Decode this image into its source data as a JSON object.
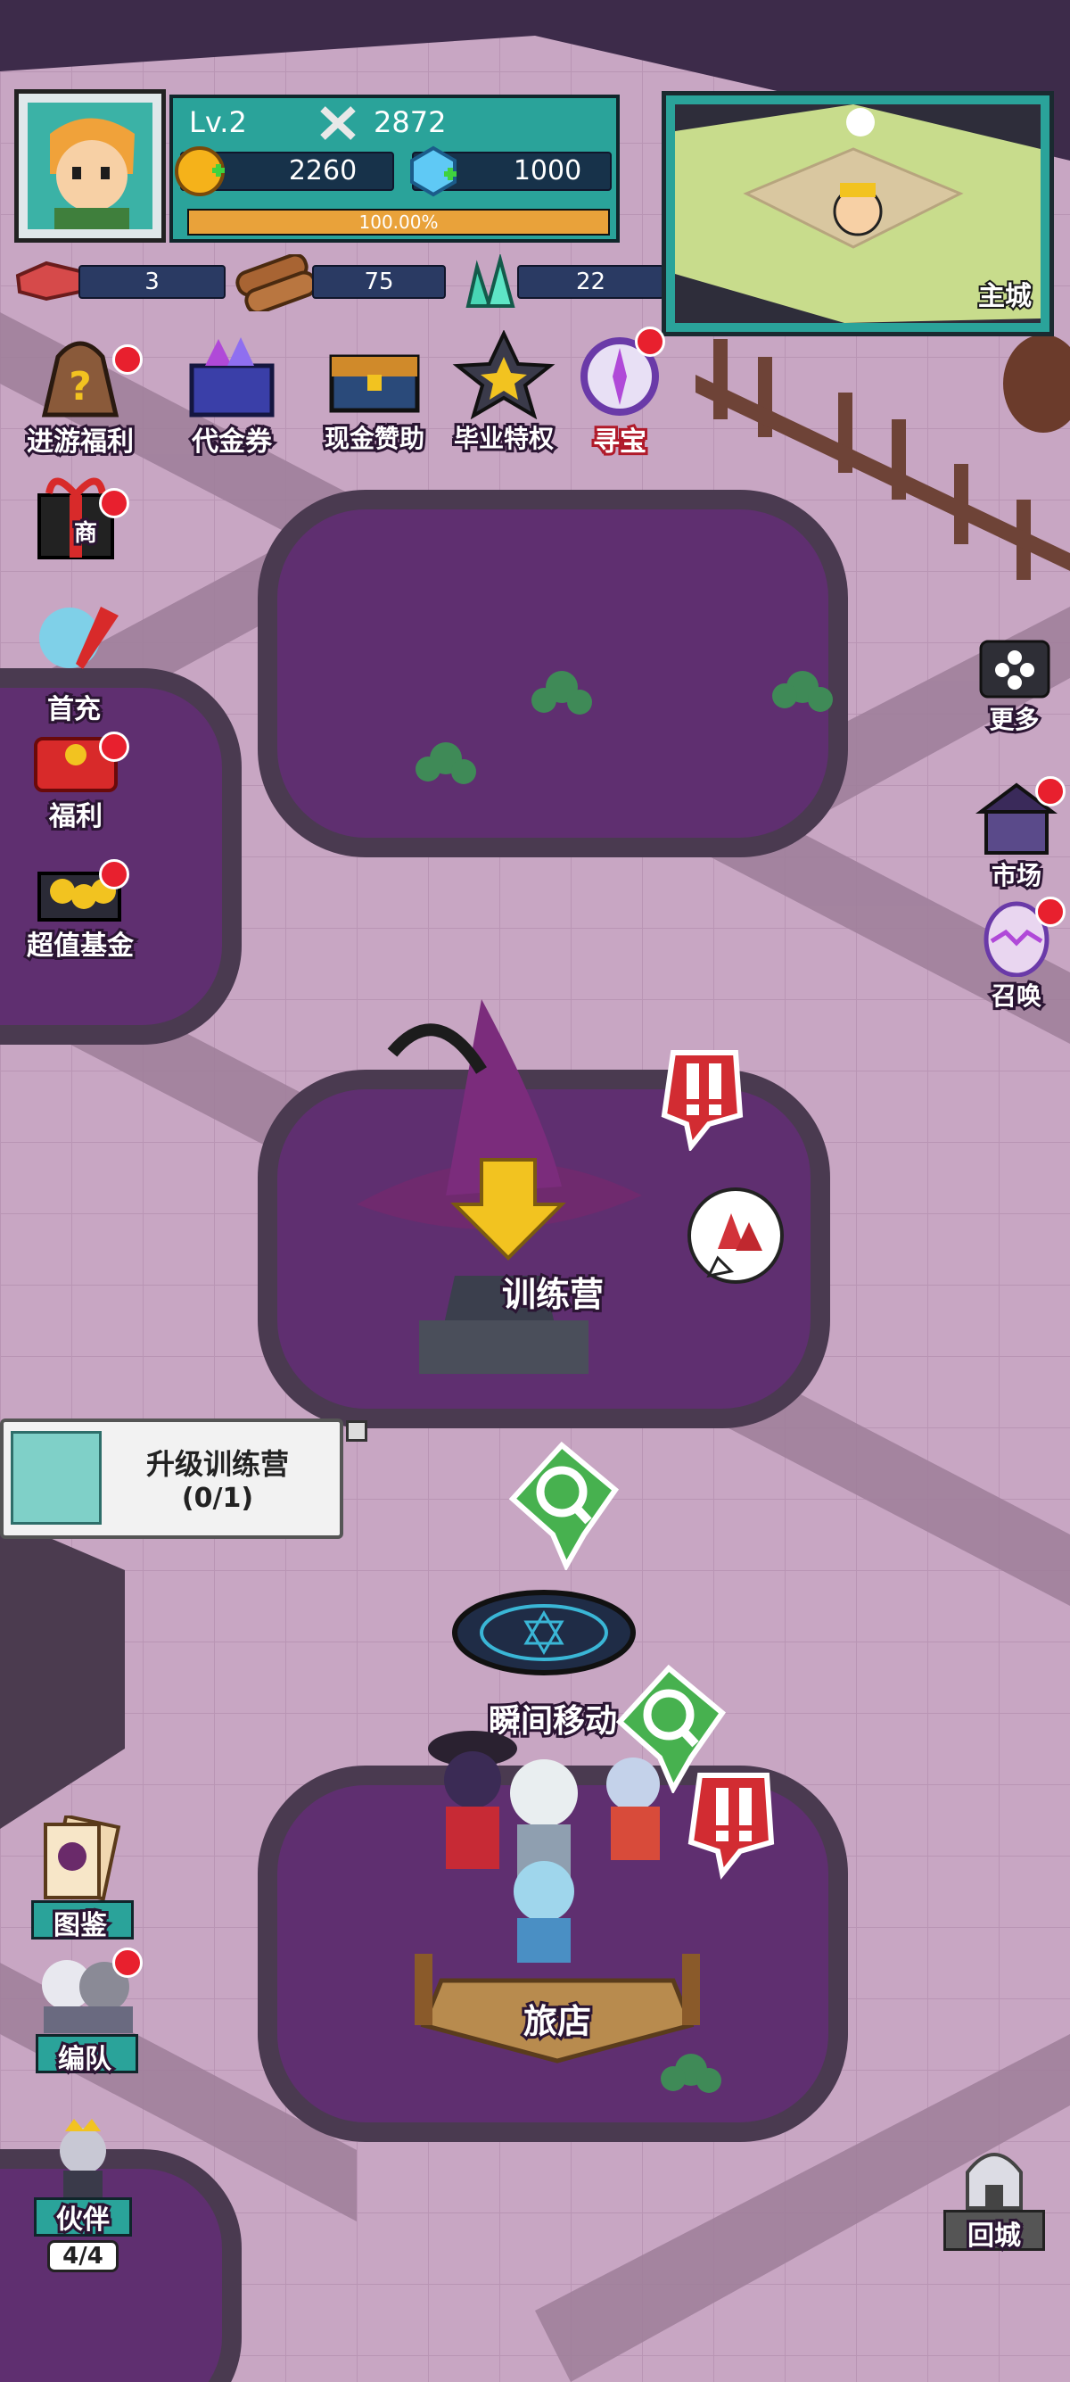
{
  "player": {
    "level": "Lv.2",
    "power": "2872",
    "gold": "2260",
    "diamond": "1000",
    "exp_percent": "100.00%",
    "exp_fraction": 1.0
  },
  "resources": [
    {
      "name": "ore",
      "icon": "ore-icon",
      "value": "3"
    },
    {
      "name": "wood",
      "icon": "wood-icon",
      "value": "75"
    },
    {
      "name": "crystal",
      "icon": "crystal-icon",
      "value": "22"
    }
  ],
  "minimap": {
    "label": "主城"
  },
  "top_menu": [
    {
      "label": "进游福利",
      "icon": "lucky-bag-icon",
      "badge": true
    },
    {
      "label": "代金券",
      "icon": "gem-box-icon",
      "badge": false
    },
    {
      "label": "现金赞助",
      "icon": "chest-icon",
      "badge": false
    },
    {
      "label": "毕业特权",
      "icon": "star-medal-icon",
      "badge": false
    },
    {
      "label": "寻宝",
      "icon": "treasure-wheel-icon",
      "badge": true
    }
  ],
  "left_menu": [
    {
      "label": "商",
      "icon": "gift-icon",
      "badge": true
    },
    {
      "label": "首充",
      "icon": "hero-sword-icon",
      "badge": false
    },
    {
      "label": "福利",
      "icon": "red-packet-icon",
      "badge": true
    },
    {
      "label": "超值基金",
      "icon": "gold-chest-icon",
      "badge": true
    }
  ],
  "right_menu": [
    {
      "label": "更多",
      "icon": "more-icon",
      "badge": false
    },
    {
      "label": "市场",
      "icon": "market-icon",
      "badge": true
    },
    {
      "label": "召唤",
      "icon": "egg-icon",
      "badge": true
    }
  ],
  "buildings": {
    "training_camp": "训练营",
    "teleport": "瞬间移动",
    "inn": "旅店"
  },
  "quest": {
    "title": "升级训练营",
    "progress": "(0/1)"
  },
  "bottom_left_menu": [
    {
      "label": "图鉴",
      "icon": "cards-icon",
      "badge": false
    },
    {
      "label": "编队",
      "icon": "team-icon",
      "badge": true
    },
    {
      "label": "伙伴",
      "icon": "partner-icon",
      "badge": false,
      "count": "4/4"
    }
  ],
  "return_city": {
    "label": "回城"
  },
  "colors": {
    "ground": "#c9a8c4",
    "road": "#a98aa6",
    "plot": "#5e2f6e",
    "panel": "#2aa39a",
    "badge": "#e8202e"
  }
}
